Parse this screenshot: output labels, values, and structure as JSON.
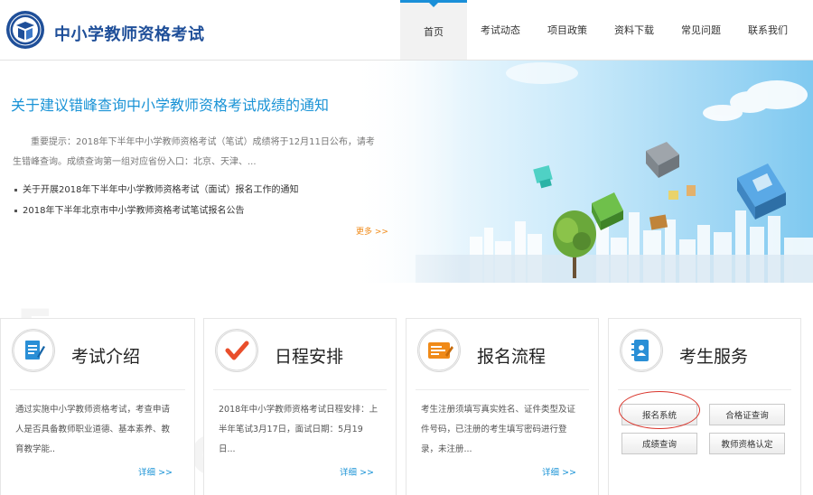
{
  "header": {
    "site_title": "中小学教师资格考试",
    "nav": [
      {
        "label": "首页",
        "active": true
      },
      {
        "label": "考试动态"
      },
      {
        "label": "项目政策"
      },
      {
        "label": "资料下载"
      },
      {
        "label": "常见问题"
      },
      {
        "label": "联系我们"
      }
    ]
  },
  "banner": {
    "notice_title": "关于建议错峰查询中小学教师资格考试成绩的通知",
    "notice_body": "重要提示：2018年下半年中小学教师资格考试（笔试）成绩将于12月11日公布，请考生错峰查询。成绩查询第一组对应省份入口：北京、天津、...",
    "links": [
      "关于开展2018年下半年中小学教师资格考试（面试）报名工作的通知",
      "2018年下半年北京市中小学教师资格考试笔试报名公告"
    ],
    "more_label": "更多 >>"
  },
  "cards": [
    {
      "title": "考试介绍",
      "icon": "document-pen-icon",
      "desc": "通过实施中小学教师资格考试，考查申请人是否具备教师职业道德、基本素养、教育教学能..",
      "more": "详细 >>",
      "color": "#2a8fd6"
    },
    {
      "title": "日程安排",
      "icon": "checkmark-icon",
      "desc": "2018年中小学教师资格考试日程安排：上半年笔试3月17日，面试日期：5月19日...",
      "more": "详细 >>",
      "color": "#e94e2b"
    },
    {
      "title": "报名流程",
      "icon": "form-icon",
      "desc": "考生注册须填写真实姓名、证件类型及证件号码，已注册的考生填写密码进行登录，未注册...",
      "more": "详细 >>",
      "color": "#f08a18"
    },
    {
      "title": "考生服务",
      "icon": "address-book-icon",
      "color": "#2a8fd6",
      "buttons": [
        "报名系统",
        "合格证查询",
        "成绩查询",
        "教师资格认定"
      ]
    }
  ]
}
